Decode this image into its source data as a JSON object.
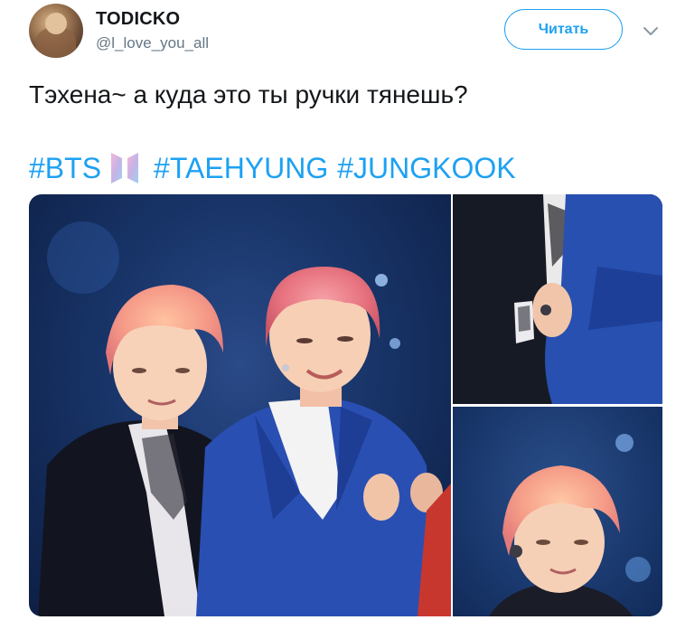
{
  "user": {
    "display_name": "TODICKO",
    "handle": "@l_love_you_all"
  },
  "actions": {
    "follow_label": "Читать"
  },
  "icons": {
    "chevron": "chevron-down-icon",
    "hashtag_emoji": "bts-logo-icon"
  },
  "tweet": {
    "text": "Тэхена~ а куда это ты ручки тянешь?",
    "hashtags": [
      "#BTS",
      "#TAEHYUNG",
      "#JUNGKOOK"
    ]
  },
  "colors": {
    "accent": "#1da1f2",
    "text": "#14171a",
    "secondary": "#657786"
  }
}
